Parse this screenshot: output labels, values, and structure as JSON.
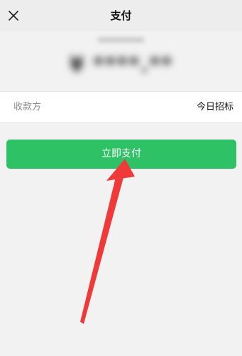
{
  "header": {
    "title": "支付",
    "close_icon": "close-icon"
  },
  "payment": {
    "merchant_obscured": "**********",
    "amount_obscured": "¥ ****.**"
  },
  "payee": {
    "label": "收款方",
    "value": "今日招标"
  },
  "actions": {
    "pay_label": "立即支付"
  },
  "colors": {
    "accent": "#2fc166",
    "annotation_arrow": "#f03a3a",
    "header_bg": "#ededed",
    "page_bg": "#f2f2f2"
  }
}
